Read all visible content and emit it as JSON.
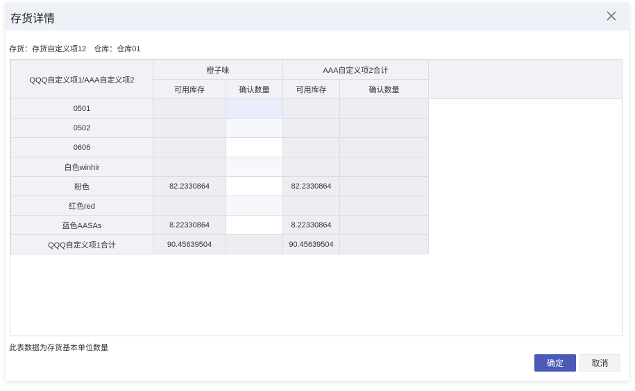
{
  "dialog": {
    "title": "存货详情",
    "subinfo": "存货：存货自定义项12　仓库：仓库01",
    "footnote": "此表数据为存货基本单位数量",
    "ok_label": "确定",
    "cancel_label": "取消",
    "close_icon": "close-icon"
  },
  "grid": {
    "corner_header": "QQQ自定义项1/AAA自定义项2",
    "groups": [
      {
        "label": "橙子味",
        "sub": [
          "可用库存",
          "确认数量"
        ]
      },
      {
        "label": "AAA自定义项2合计",
        "sub": [
          "可用库存",
          "确认数量"
        ]
      }
    ],
    "rows": [
      {
        "label": "0501",
        "g1_avail": "",
        "g1_confirm": "",
        "g2_avail": "",
        "g2_confirm": ""
      },
      {
        "label": "0502",
        "g1_avail": "",
        "g1_confirm": "",
        "g2_avail": "",
        "g2_confirm": ""
      },
      {
        "label": "0606",
        "g1_avail": "",
        "g1_confirm": "",
        "g2_avail": "",
        "g2_confirm": ""
      },
      {
        "label": "白色winhir",
        "g1_avail": "",
        "g1_confirm": "",
        "g2_avail": "",
        "g2_confirm": ""
      },
      {
        "label": "粉色",
        "g1_avail": "82.2330864",
        "g1_confirm": "",
        "g2_avail": "82.2330864",
        "g2_confirm": ""
      },
      {
        "label": "红色red",
        "g1_avail": "",
        "g1_confirm": "",
        "g2_avail": "",
        "g2_confirm": ""
      },
      {
        "label": "蓝色AASAs",
        "g1_avail": "8.22330864",
        "g1_confirm": "",
        "g2_avail": "8.22330864",
        "g2_confirm": ""
      },
      {
        "label": "QQQ自定义项1合计",
        "g1_avail": "90.45639504",
        "g1_confirm": "",
        "g2_avail": "90.45639504",
        "g2_confirm": ""
      }
    ]
  },
  "colors": {
    "primary": "#4a5ab6",
    "header_bg": "#f0f2f5",
    "readonly_bg": "#eceef2",
    "titlebar_bg": "#eef1f8"
  }
}
